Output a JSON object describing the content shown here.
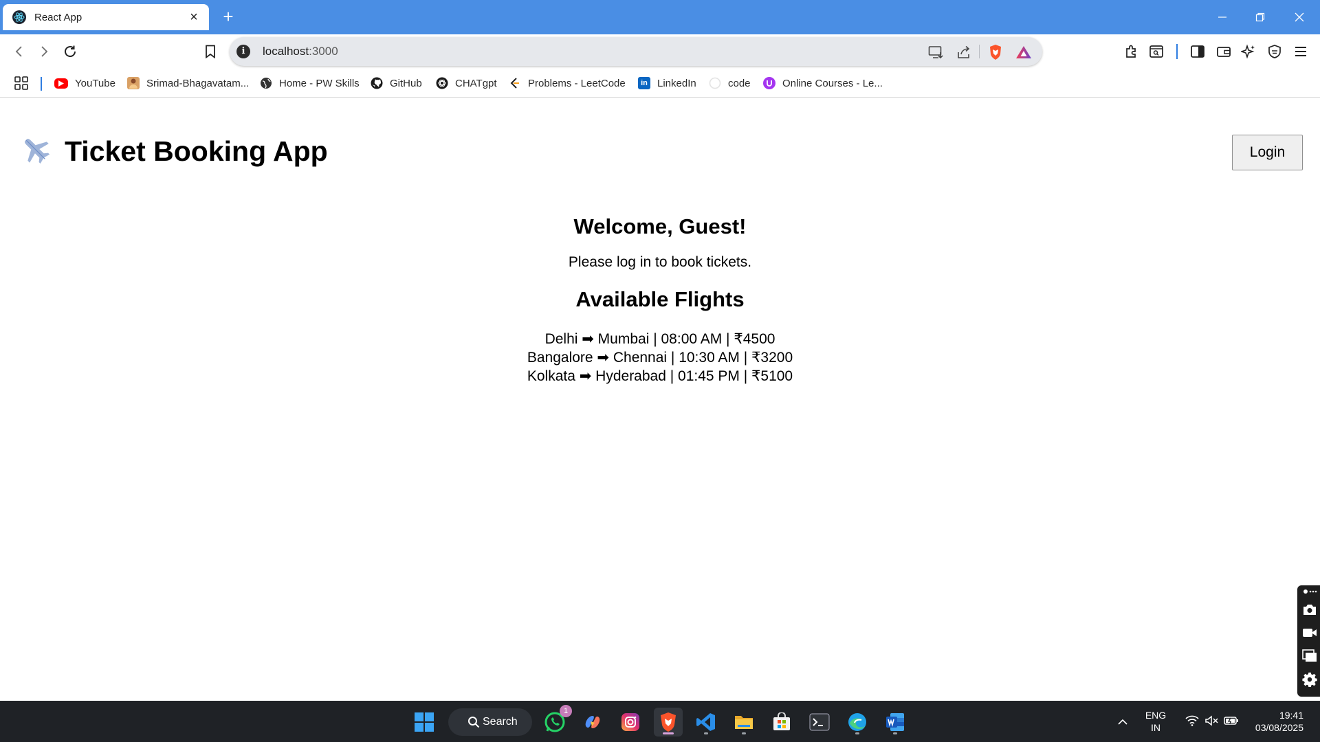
{
  "browser": {
    "tab": {
      "title": "React App"
    },
    "address": {
      "host": "localhost",
      "port": ":3000"
    },
    "bookmarks": [
      {
        "label": "YouTube",
        "icon": "youtube-icon"
      },
      {
        "label": "Srimad-Bhagavatam...",
        "icon": "srimad-icon"
      },
      {
        "label": "Home - PW Skills",
        "icon": "globe-icon"
      },
      {
        "label": "GitHub",
        "icon": "github-icon"
      },
      {
        "label": "CHATgpt",
        "icon": "chatgpt-icon"
      },
      {
        "label": "Problems - LeetCode",
        "icon": "leetcode-icon"
      },
      {
        "label": "LinkedIn",
        "icon": "linkedin-icon"
      },
      {
        "label": "code",
        "icon": "code-icon"
      },
      {
        "label": "Online Courses - Le...",
        "icon": "udemy-icon"
      }
    ]
  },
  "app": {
    "title": "Ticket Booking App",
    "logo_icon": "airplane-icon",
    "login_label": "Login",
    "welcome": "Welcome, Guest!",
    "prompt": "Please log in to book tickets.",
    "flights_heading": "Available Flights",
    "flights": [
      "Delhi ➡ Mumbai | 08:00 AM | ₹4500",
      "Bangalore ➡ Chennai | 10:30 AM | ₹3200",
      "Kolkata ➡ Hyderabad | 01:45 PM | ₹5100"
    ]
  },
  "taskbar": {
    "search_label": "Search",
    "whatsapp_badge": "1",
    "language": "ENG",
    "region": "IN",
    "time": "19:41",
    "date": "03/08/2025"
  },
  "colors": {
    "titlebar": "#4a8ee4",
    "taskbar": "#1f2226",
    "brave_orange": "#fb542b"
  }
}
